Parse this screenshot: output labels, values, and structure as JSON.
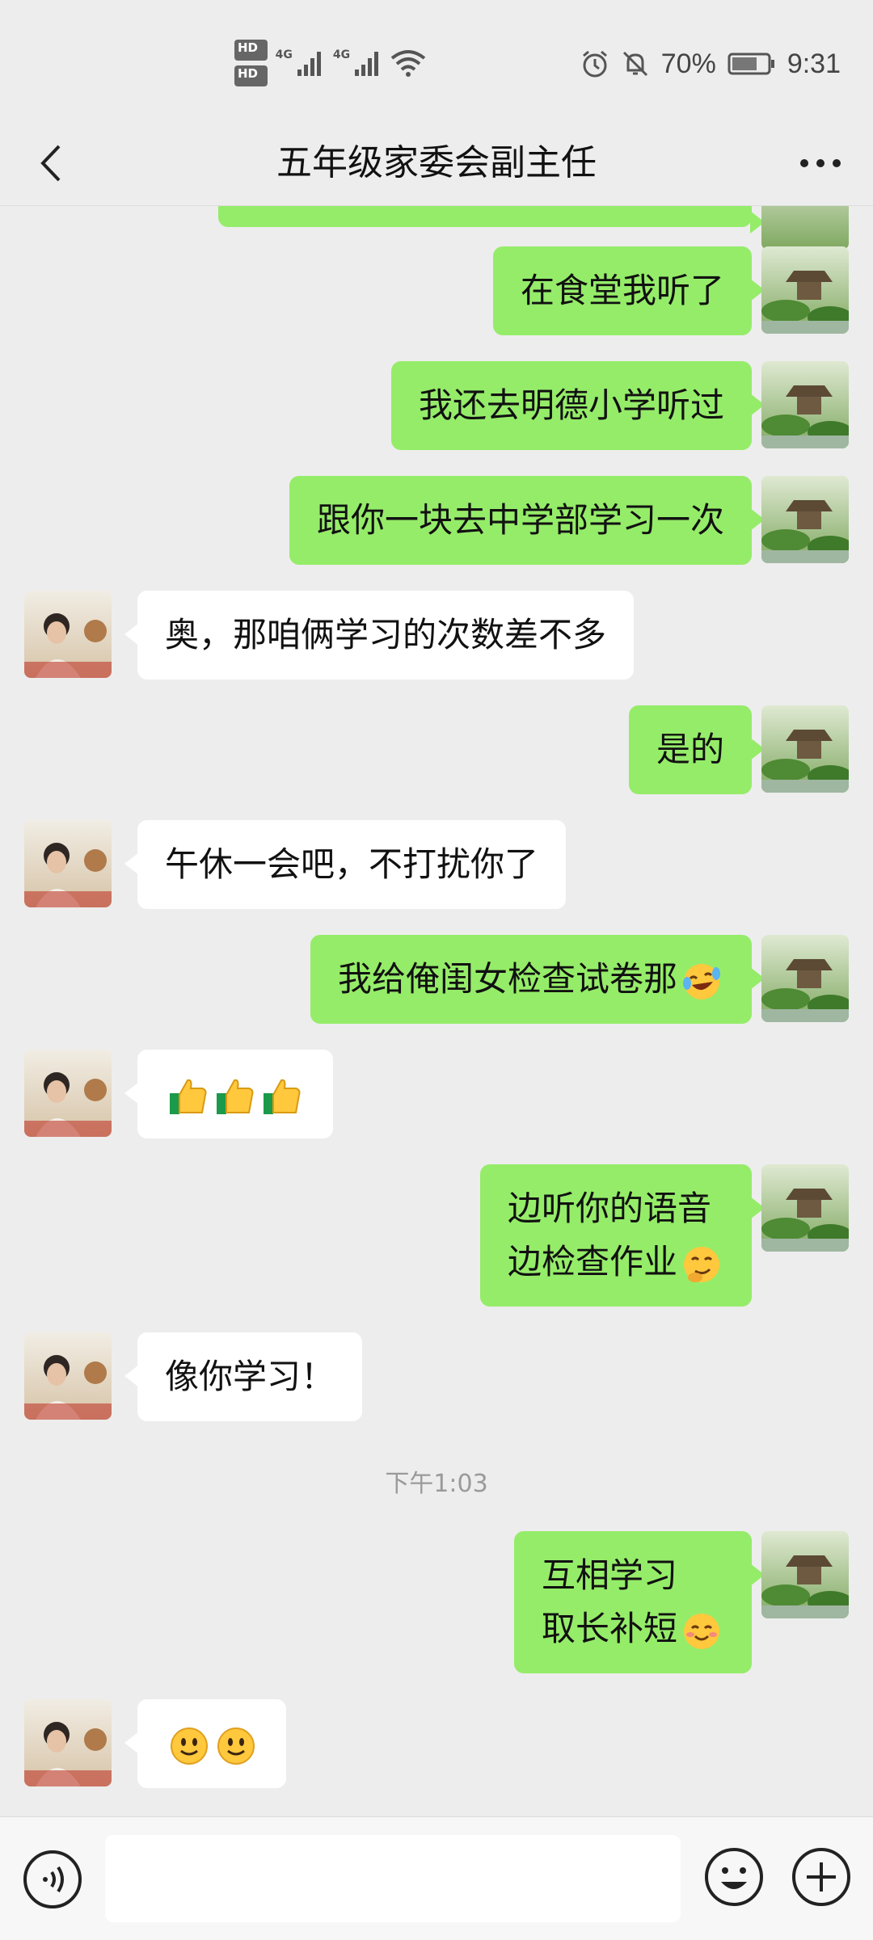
{
  "status_bar": {
    "hd1": "HD",
    "hd2": "HD",
    "sim1": "1",
    "sim2": "2",
    "net1": "4G",
    "net2": "4G",
    "battery_pct": "70%",
    "time": "9:31"
  },
  "nav": {
    "title": "五年级家委会副主任"
  },
  "messages": [
    {
      "from": "me",
      "text": "在食堂我听了"
    },
    {
      "from": "me",
      "text": "我还去明德小学听过"
    },
    {
      "from": "me",
      "text": "跟你一块去中学部学习一次"
    },
    {
      "from": "other",
      "text": "奥，那咱俩学习的次数差不多"
    },
    {
      "from": "me",
      "text": "是的"
    },
    {
      "from": "other",
      "text": "午休一会吧，不打扰你了"
    },
    {
      "from": "me",
      "text": "我给俺闺女检查试卷那",
      "emoji": "laugh-cry-emoji"
    },
    {
      "from": "other",
      "text": "",
      "emoji": "thumbs-up-emoji x3"
    },
    {
      "from": "me",
      "text": "边听你的语音\n边检查作业",
      "emoji": "smirk-emoji"
    },
    {
      "from": "other",
      "text": "像你学习！"
    },
    {
      "from": "me",
      "text": "互相学习\n取长补短",
      "emoji": "blush-emoji"
    },
    {
      "from": "other",
      "text": "",
      "emoji": "smile-emoji x2"
    }
  ],
  "timestamp": "下午1:03",
  "colors": {
    "me_bubble": "#95ec69",
    "other_bubble": "#ffffff",
    "background": "#ededed"
  }
}
